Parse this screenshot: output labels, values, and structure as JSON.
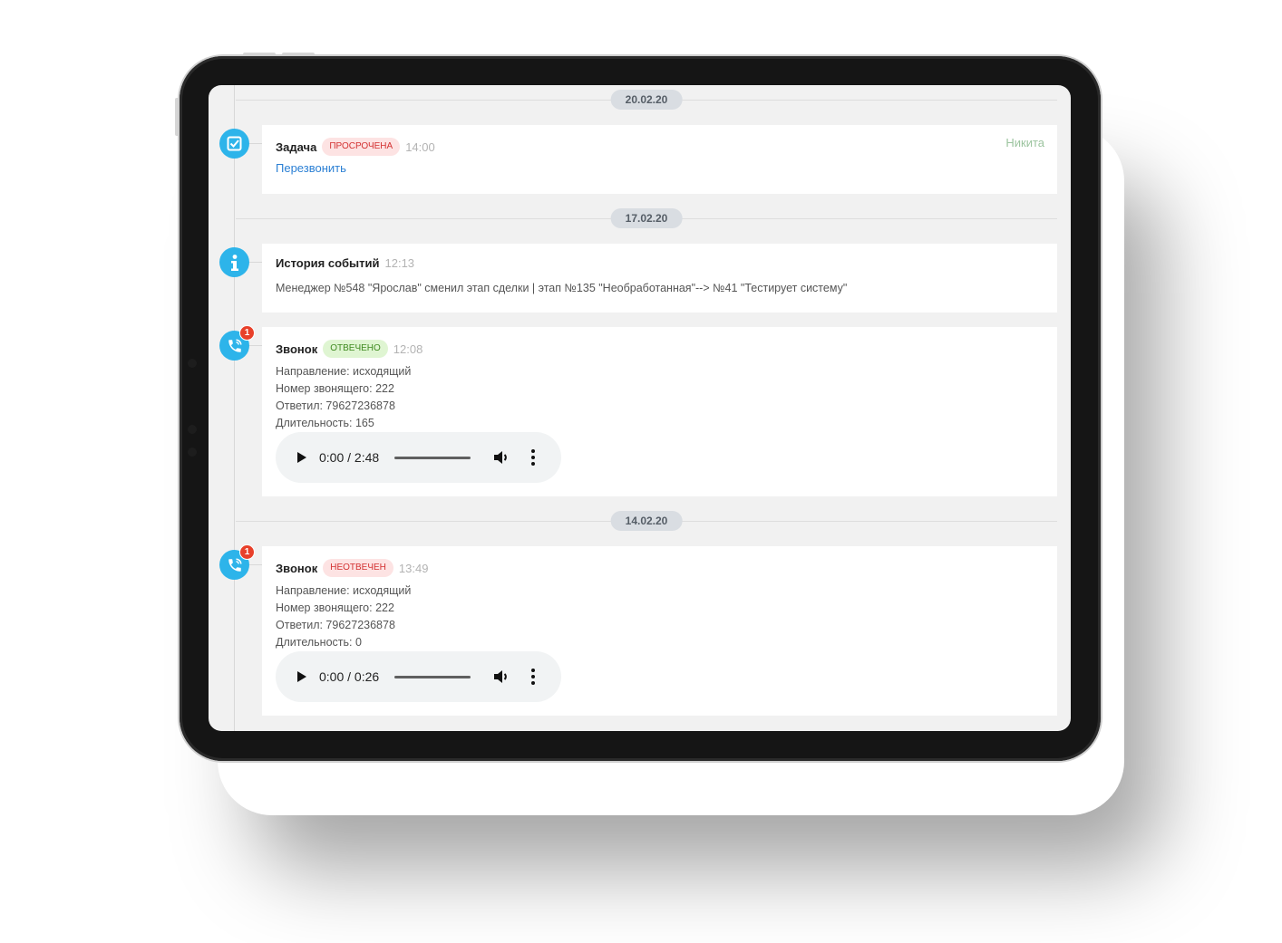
{
  "dates": [
    "20.02.20",
    "17.02.20",
    "14.02.20"
  ],
  "task": {
    "title": "Задача",
    "status": "просрочена",
    "time": "14:00",
    "assignee": "Никита",
    "action": "Перезвонить"
  },
  "history": {
    "title": "История событий",
    "time": "12:13",
    "text": "Менеджер №548 \"Ярослав\" сменил этап сделки | этап №135 \"Необработанная\"--> №41 \"Тестирует систему\""
  },
  "call1": {
    "title": "Звонок",
    "status": "отвечено",
    "time": "12:08",
    "badge": "1",
    "lines": [
      "Направление: исходящий",
      "Номер звонящего: 222",
      "Ответил: 79627236878",
      "Длительность: 165"
    ],
    "player_time": "0:00 / 2:48"
  },
  "call2": {
    "title": "Звонок",
    "status": "неотвечен",
    "time": "13:49",
    "badge": "1",
    "lines": [
      "Направление: исходящий",
      "Номер звонящего: 222",
      "Ответил: 79627236878",
      "Длительность: 0"
    ],
    "player_time": "0:00 / 0:26"
  },
  "colors": {
    "accent": "#2db4ea",
    "badge": "#e8402a",
    "overdue": "#d33232",
    "answered": "#3f8a20",
    "link": "#2a7fd4"
  },
  "icons": [
    "task-check-icon",
    "info-icon",
    "phone-icon",
    "play-icon",
    "volume-icon",
    "more-vert-icon"
  ]
}
